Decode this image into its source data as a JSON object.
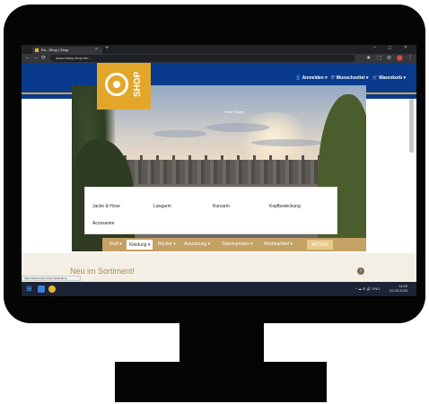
{
  "browser": {
    "tab_title": "Ro...Shop | Shop",
    "tab_close": "×",
    "new_tab": "+",
    "window_controls": "‒ ◻ ✕",
    "nav_back": "←",
    "nav_forward": "→",
    "nav_reload": "⟳",
    "url": "www.rotary-shop.de/...",
    "ext_icons": [
      "★",
      "⬚",
      "⊘",
      "⬤",
      "⋮"
    ]
  },
  "header": {
    "user_links": [
      "👤 Anmelden ▾",
      "♡ Wunschzettel ▾",
      "🛒 Warenkorb ▾"
    ],
    "logo_text": "SHOP"
  },
  "hero": {
    "caption": "Foto: Rotary"
  },
  "dropdown": {
    "items": [
      "Jacke & Hose",
      "Langarm",
      "Kurzarm",
      "Kopfbedeckung",
      "Accessoire"
    ]
  },
  "nav": {
    "items": [
      {
        "label": "Kluft ▾",
        "state": "normal"
      },
      {
        "label": "Kleidung ▾",
        "state": "active"
      },
      {
        "label": "Bücher ▾",
        "state": "normal"
      },
      {
        "label": "Ausrüstung ▾",
        "state": "normal"
      },
      {
        "label": "Stammposten ▾",
        "state": "normal"
      },
      {
        "label": "Werbeartikel ▾",
        "state": "normal"
      },
      {
        "label": "AKTION",
        "state": "highlight"
      }
    ]
  },
  "section": {
    "title": "Neu im Sortiment!",
    "arrow": "›"
  },
  "status_tip": "https://www.rotary-shop.de/kleidung",
  "taskbar": {
    "start_icon": "⊞",
    "tray_text": "^ ☁ ⊕ 🔊 ENG",
    "time": "14:03",
    "date": "22.03.2023"
  },
  "colors": {
    "header_blue": "#0a3a8c",
    "logo_gold": "#e2a72a",
    "nav_tan": "#c4a164",
    "section_title": "#aa8b55"
  }
}
